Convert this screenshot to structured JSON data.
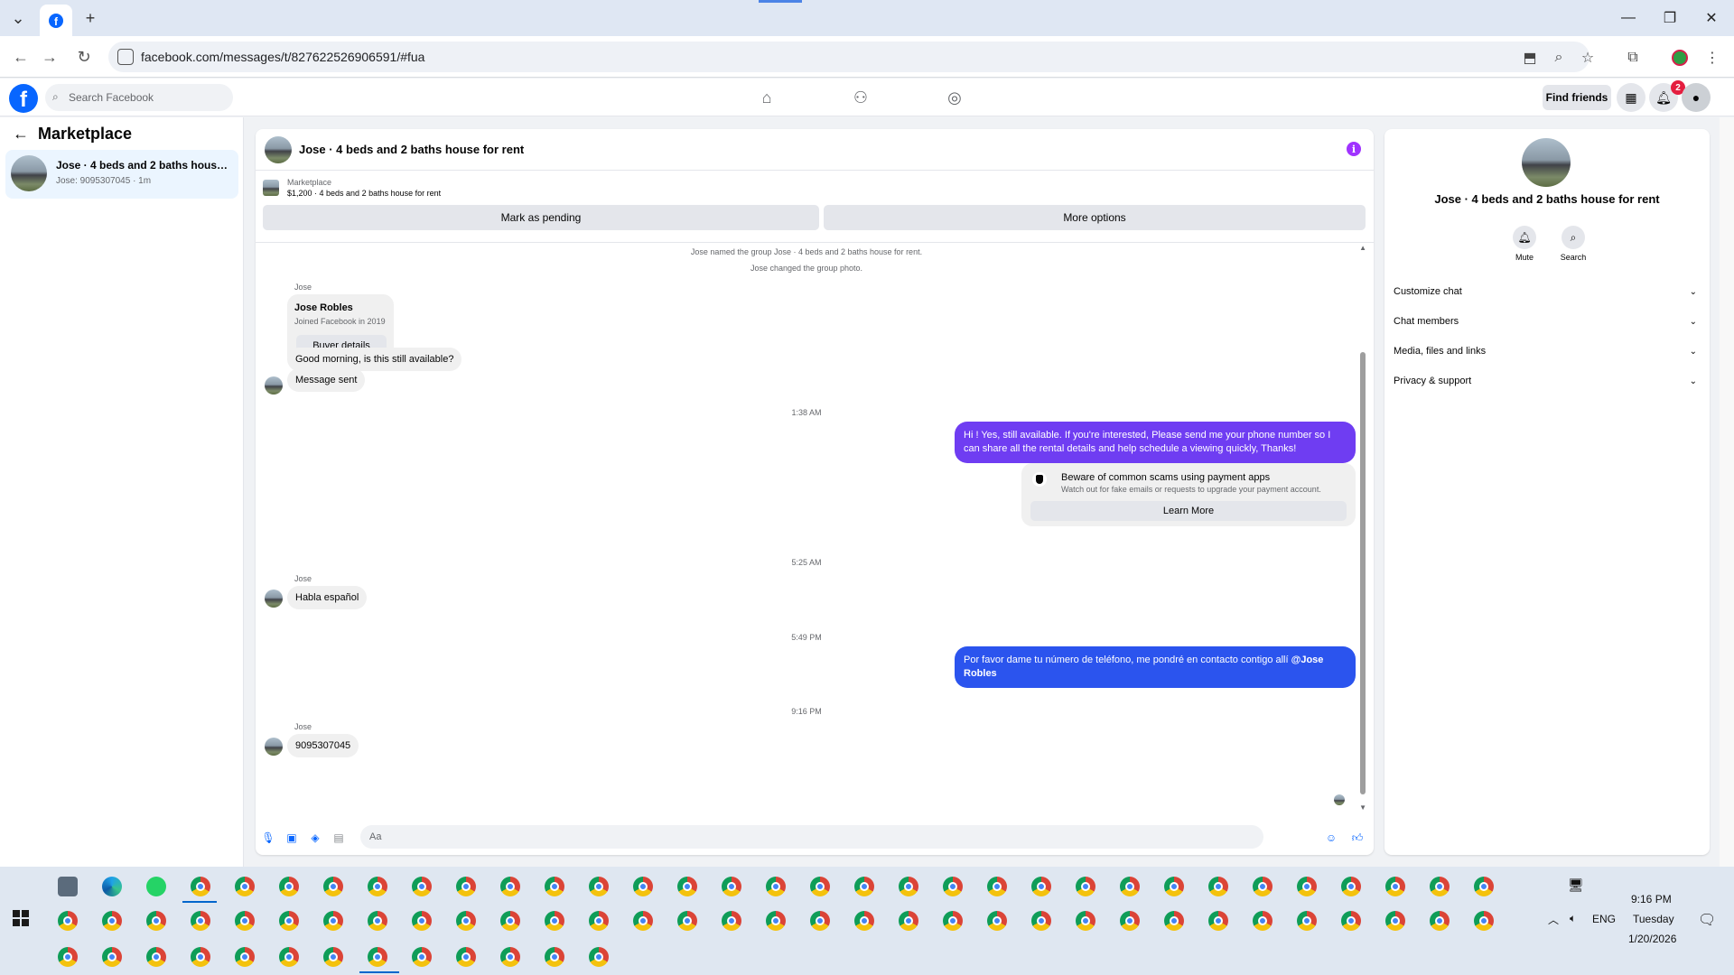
{
  "browser": {
    "url": "facebook.com/messages/t/827622526906591/#fua"
  },
  "fb": {
    "search_placeholder": "Search Facebook",
    "find_friends": "Find friends",
    "notification_count": "2"
  },
  "sidebar": {
    "title": "Marketplace",
    "item_title": "Jose · 4 beds and 2 baths house fo...",
    "item_sub": "Jose: 9095307045 · 1m"
  },
  "chat": {
    "title": "Jose · 4 beds and 2 baths house for rent",
    "listing_source": "Marketplace",
    "listing_price": "$1,200 · 4 beds and 2 baths house for rent",
    "mark_pending": "Mark as pending",
    "more_options": "More options",
    "sys1": "Jose named the group Jose · 4 beds and 2 baths house for rent.",
    "sys2": "Jose changed the group photo.",
    "sender_jose": "Jose",
    "card_name": "Jose Robles",
    "card_sub": "Joined Facebook in 2019",
    "card_btn": "Buyer details",
    "msg1": "Good morning, is this still available?",
    "msg2": "Message sent",
    "time1": "1:38 AM",
    "out1": "Hi ! Yes, still available. If you're interested, Please send me your phone number so I can share all the rental details and help schedule a viewing quickly, Thanks!",
    "warn_title": "Beware of common scams using payment apps",
    "warn_sub": "Watch out for fake emails or requests to upgrade your payment account.",
    "warn_btn": "Learn More",
    "time2": "5:25 AM",
    "msg3": "Habla español",
    "time3": "5:49 PM",
    "out2": "Por favor dame tu número de teléfono, me pondré en contacto contigo allí ",
    "out2_mention": "@Jose Robles",
    "time4": "9:16 PM",
    "msg4": "9095307045",
    "composer_placeholder": "Aa"
  },
  "rightpanel": {
    "title": "Jose · 4 beds and 2 baths house for rent",
    "mute": "Mute",
    "search": "Search",
    "rows": [
      "Customize chat",
      "Chat members",
      "Media, files and links",
      "Privacy & support"
    ]
  },
  "taskbar": {
    "time": "9:16 PM",
    "day": "Tuesday",
    "date": "1/20/2026",
    "lang": "ENG"
  },
  "colors": {
    "fb_blue": "#0866ff",
    "outgoing_purple": "#6f3df2",
    "outgoing_blue": "#2b54ee"
  }
}
